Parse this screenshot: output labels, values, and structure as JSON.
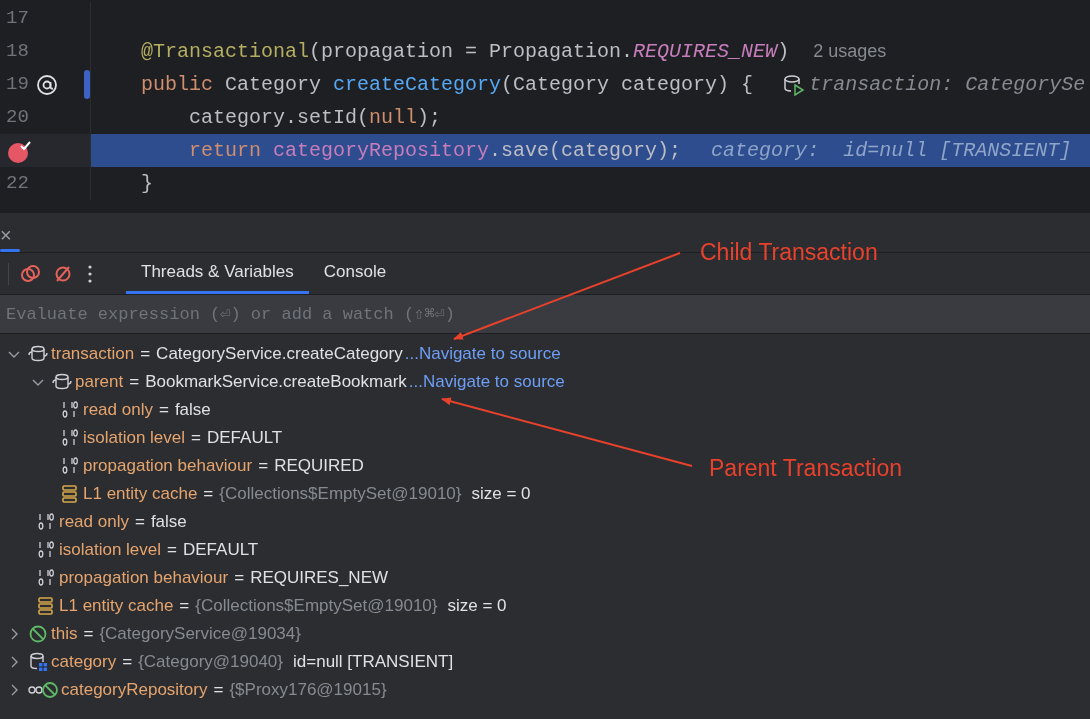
{
  "editor": {
    "lines": [
      {
        "number": "17"
      },
      {
        "number": "18",
        "tokens": [
          {
            "text": "@Transactional",
            "kind": "annotation"
          },
          {
            "text": "(propagation = Propagation.",
            "kind": "plain"
          },
          {
            "text": "REQUIRES_NEW",
            "kind": "constant"
          },
          {
            "text": ")",
            "kind": "plain"
          }
        ],
        "hint": "2 usages"
      },
      {
        "number": "19",
        "gutter": {
          "kind": "override"
        },
        "changed": true,
        "tokens": [
          {
            "text": "public",
            "kind": "keyword"
          },
          {
            "text": " Category ",
            "kind": "plain"
          },
          {
            "text": "createCategory",
            "kind": "method"
          },
          {
            "text": "(Category category) {",
            "kind": "plain"
          }
        ],
        "inlay": "transaction: CategorySe"
      },
      {
        "number": "20",
        "tokens": [
          {
            "text": "    category.setId(",
            "kind": "plain"
          },
          {
            "text": "null",
            "kind": "keyword"
          },
          {
            "text": ");",
            "kind": "plain"
          }
        ]
      },
      {
        "gutter": {
          "kind": "breakpoint"
        },
        "highlighted": true,
        "tokens": [
          {
            "text": "    return ",
            "kind": "keyword"
          },
          {
            "text": "categoryRepository",
            "kind": "field"
          },
          {
            "text": ".save(category);",
            "kind": "plain"
          }
        ],
        "inline_value": "category:  id=null [TRANSIENT]"
      },
      {
        "number": "22",
        "tokens": [
          {
            "text": "}",
            "kind": "plain"
          }
        ]
      }
    ]
  },
  "debugger": {
    "close": "×",
    "tabs": [
      {
        "label": "Threads & Variables",
        "selected": true
      },
      {
        "label": "Console",
        "selected": false
      }
    ],
    "evaluate": {
      "placeholder": "Evaluate expression (⏎) or add a watch (⇧⌘⏎)"
    },
    "variables": [
      {
        "kind": "transaction",
        "name": "transaction",
        "op": "=",
        "value": "CategoryService.createCategory",
        "link": "...Navigate to source",
        "expanded": true,
        "children": [
          {
            "kind": "transaction",
            "name": "parent",
            "op": "=",
            "value": "BookmarkService.createBookmark",
            "link": "...Navigate to source",
            "expanded": true,
            "children": [
              {
                "kind": "primitive",
                "name": "read only",
                "op": "=",
                "value": "false"
              },
              {
                "kind": "primitive",
                "name": "isolation level",
                "op": "=",
                "value": "DEFAULT"
              },
              {
                "kind": "primitive",
                "name": "propagation behaviour",
                "op": "=",
                "value": "REQUIRED"
              },
              {
                "kind": "collection",
                "name": "L1 entity cache",
                "op": "=",
                "ref": "{Collections$EmptySet@19010}",
                "extra": "size = 0"
              }
            ]
          },
          {
            "kind": "primitive",
            "name": "read only",
            "op": "=",
            "value": "false"
          },
          {
            "kind": "primitive",
            "name": "isolation level",
            "op": "=",
            "value": "DEFAULT"
          },
          {
            "kind": "primitive",
            "name": "propagation behaviour",
            "op": "=",
            "value": "REQUIRES_NEW"
          },
          {
            "kind": "collection",
            "name": "L1 entity cache",
            "op": "=",
            "ref": "{Collections$EmptySet@19010}",
            "extra": "size = 0"
          }
        ]
      },
      {
        "kind": "blocked",
        "name": "this",
        "op": "=",
        "ref": "{CategoryService@19034}",
        "expanded": false
      },
      {
        "kind": "entity",
        "name": "category",
        "op": "=",
        "ref": "{Category@19040}",
        "extra": "id=null [TRANSIENT]",
        "expanded": false
      },
      {
        "kind": "proxy",
        "name": "categoryRepository",
        "op": "=",
        "ref": "{$Proxy176@19015}",
        "expanded": false
      }
    ]
  },
  "annotations": [
    {
      "label": "Child Transaction"
    },
    {
      "label": "Parent Transaction"
    }
  ]
}
